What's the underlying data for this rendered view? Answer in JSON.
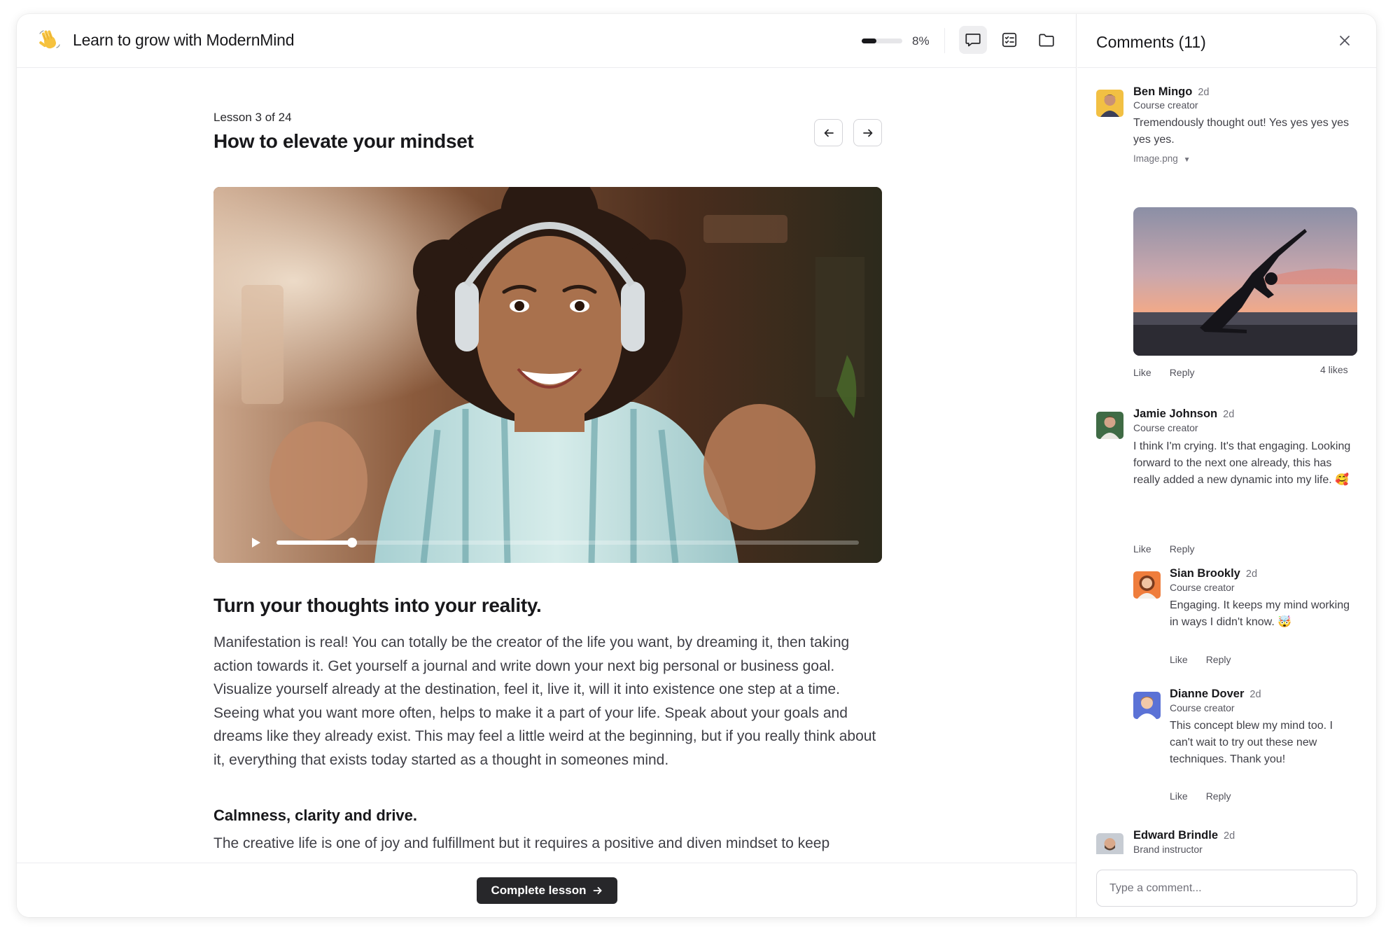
{
  "header": {
    "emoji": "👋",
    "title": "Learn to grow with ModernMind",
    "progress_label": "8%",
    "progress_value": 0.08
  },
  "toolbar": {
    "comments_icon": "chat-bubble-icon",
    "checklist_icon": "checklist-icon",
    "files_icon": "folder-icon"
  },
  "lesson": {
    "counter": "Lesson 3 of 24",
    "title": "How to elevate your mindset",
    "video_progress": 0.13
  },
  "article": {
    "heading": "Turn your thoughts into your reality.",
    "paragraph": "Manifestation is real! You can totally be the creator of the life you want, by dreaming it, then taking action towards it. Get yourself a journal and write down your next big personal or business goal. Visualize yourself already at the destination, feel it, live it, will it into existence one step at a time. Seeing what you want more often, helps to make it a part of your life. Speak about your goals and dreams like they already exist. This may feel a little weird at the beginning, but if you really think about it, everything that exists today started as a thought in someones mind.",
    "subheading": "Calmness, clarity and drive.",
    "paragraph2": "The creative life is one of joy and fulfillment but it requires a positive and diven mindset to keep"
  },
  "footer": {
    "complete_label": "Complete lesson"
  },
  "comments_panel": {
    "title": "Comments (11)",
    "input_placeholder": "Type a comment...",
    "like_label": "Like",
    "reply_label": "Reply",
    "comments": [
      {
        "name": "Ben Mingo",
        "time": "2d",
        "role": "Course creator",
        "text": "Tremendously thought out! Yes yes yes yes yes yes.",
        "attachment": "Image.png",
        "likes": "4 likes"
      },
      {
        "name": "Jamie Johnson",
        "time": "2d",
        "role": "Course creator",
        "text": "I think I'm crying. It's that engaging. Looking forward to the next one already, this has really added a new dynamic into my life. 🥰"
      },
      {
        "name": "Sian Brookly",
        "time": "2d",
        "role": "Course creator",
        "text": "Engaging. It keeps my mind working in ways I didn't know. 🤯"
      },
      {
        "name": "Dianne Dover",
        "time": "2d",
        "role": "Course creator",
        "text": "This concept blew my mind too. I can't wait to try out these new techniques. Thank you!"
      },
      {
        "name": "Edward Brindle",
        "time": "2d",
        "role": "Brand instructor"
      }
    ]
  },
  "colors": {
    "text_primary": "#18181b",
    "text_body": "#3f3f46",
    "button_dark": "#27272a",
    "border": "#ececef"
  }
}
